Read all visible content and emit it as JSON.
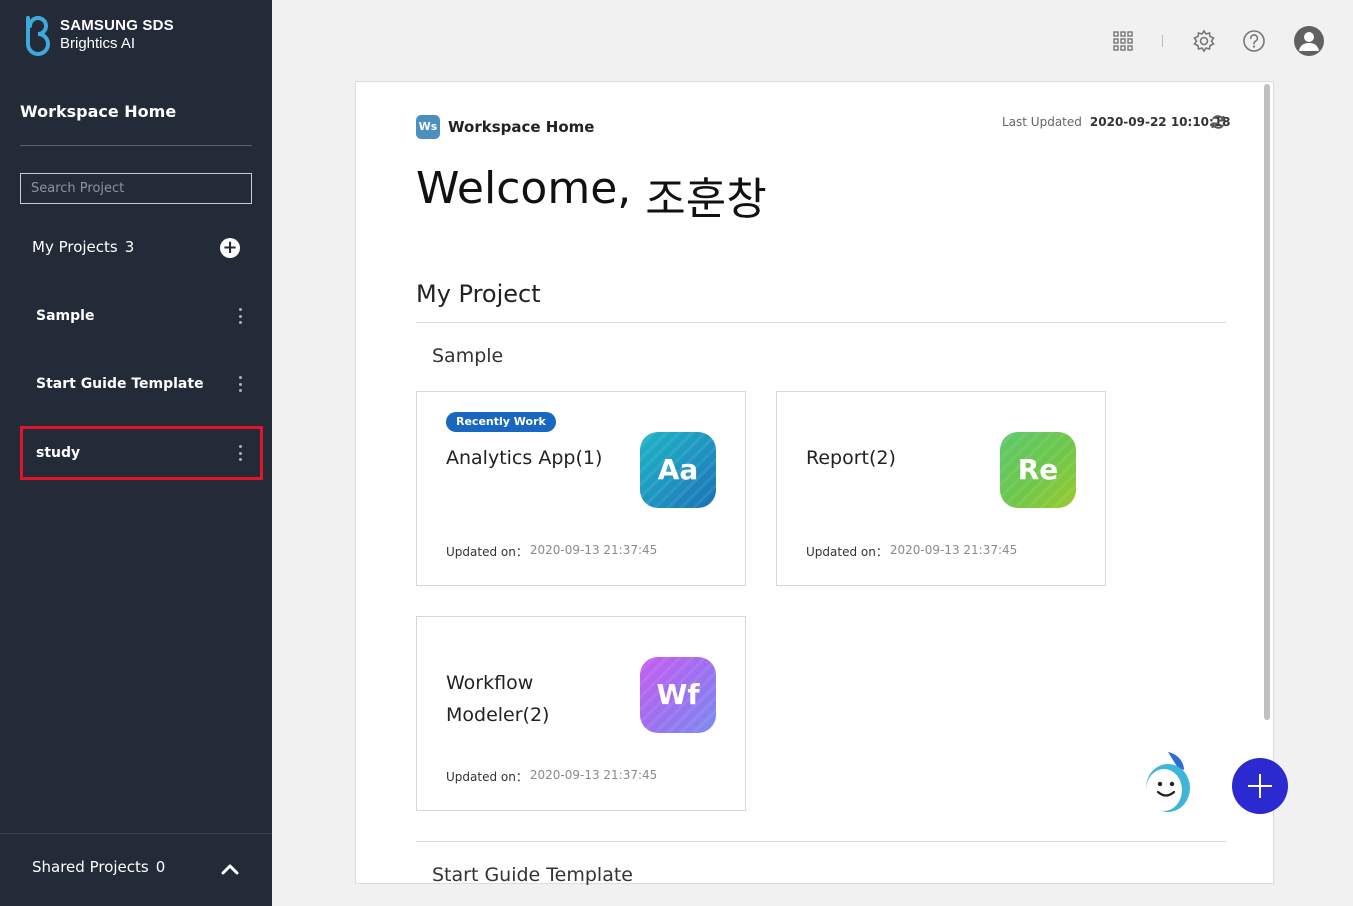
{
  "brand": {
    "line1": "SAMSUNG SDS",
    "line2": "Brightics AI"
  },
  "sidebar": {
    "home_label": "Workspace Home",
    "search_placeholder": "Search Project",
    "my_projects_label": "My Projects",
    "my_projects_count": "3",
    "projects": [
      {
        "label": "Sample"
      },
      {
        "label": "Start Guide Template"
      },
      {
        "label": "study",
        "selected": true
      }
    ],
    "shared_projects_label": "Shared Projects",
    "shared_projects_count": "0"
  },
  "topbar": {
    "icons": [
      "apps-grid-icon",
      "settings-gear-icon",
      "help-icon",
      "user-avatar-icon"
    ]
  },
  "main": {
    "badge": "Ws",
    "title": "Workspace Home",
    "last_updated_label": "Last Updated",
    "last_updated_value": "2020-09-22 10:10:18",
    "welcome_prefix": "Welcome,",
    "welcome_name": "조훈창",
    "section_title": "My Project",
    "groups": [
      {
        "name": "Sample",
        "cards": [
          {
            "tag": "Recently Work",
            "title": "Analytics App(1)",
            "icon": "Aa",
            "updated_label": "Updated on：",
            "updated_value": "2020-09-13 21:37:45"
          },
          {
            "title": "Report(2)",
            "icon": "Re",
            "updated_label": "Updated on：",
            "updated_value": "2020-09-13 21:37:45"
          },
          {
            "title": "Workflow Modeler(2)",
            "icon": "Wf",
            "updated_label": "Updated on：",
            "updated_value": "2020-09-13 21:37:45"
          }
        ]
      },
      {
        "name": "Start Guide Template"
      }
    ]
  },
  "colors": {
    "sidebar_bg": "#232a38",
    "accent": "#1967c0",
    "fab": "#2a2ad0",
    "highlight": "#e0152a"
  }
}
